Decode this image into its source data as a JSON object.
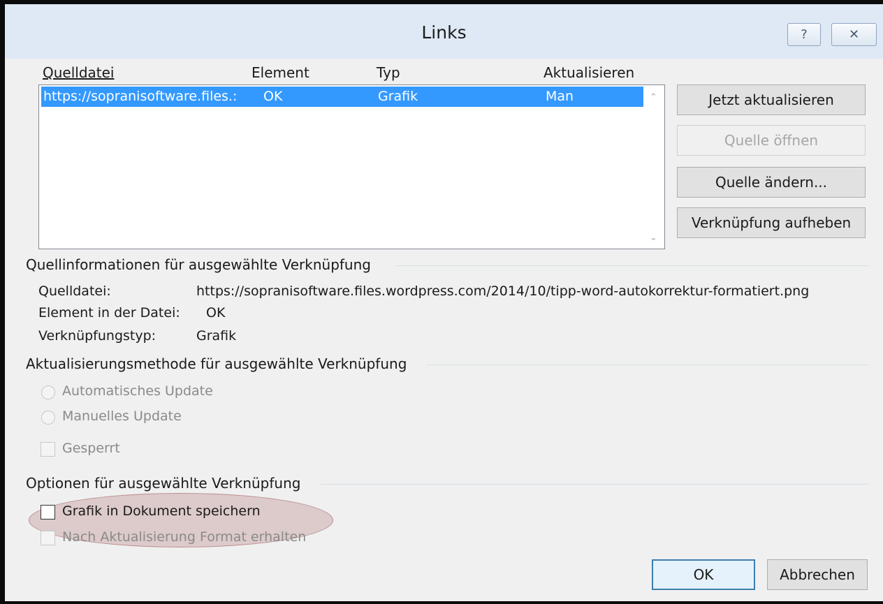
{
  "window": {
    "title": "Links",
    "help_glyph": "?",
    "close_glyph": "✕"
  },
  "list": {
    "columns": [
      "Quelldatei",
      "Element",
      "Typ",
      "Aktualisieren"
    ],
    "rows": [
      {
        "quelldatei": "https://sopranisoftware.files.:",
        "element": "OK",
        "typ": "Grafik",
        "aktualisieren": "Man"
      }
    ]
  },
  "buttons": {
    "update_now": "Jetzt aktualisieren",
    "open_source": "Quelle öffnen",
    "change_source": "Quelle ändern...",
    "break_link": "Verknüpfung aufheben",
    "ok": "OK",
    "cancel": "Abbrechen"
  },
  "source_info": {
    "heading": "Quellinformationen für ausgewählte Verknüpfung",
    "file_label": "Quelldatei:",
    "file_value": "https://sopranisoftware.files.wordpress.com/2014/10/tipp-word-autokorrektur-formatiert.png",
    "element_label": "Element in der Datei:",
    "element_value": "OK",
    "type_label": "Verknüpfungstyp:",
    "type_value": "Grafik"
  },
  "update_method": {
    "heading": "Aktualisierungsmethode für ausgewählte Verknüpfung",
    "auto": "Automatisches Update",
    "manual": "Manuelles Update",
    "locked": "Gesperrt"
  },
  "options": {
    "heading": "Optionen für ausgewählte Verknüpfung",
    "save_in_doc": "Grafik in Dokument speichern",
    "keep_format": "Nach Aktualisierung Format erhalten"
  },
  "colors": {
    "selection": "#3399ff",
    "highlight": "#be8c8c",
    "titlebar": "#dfe9f5"
  }
}
